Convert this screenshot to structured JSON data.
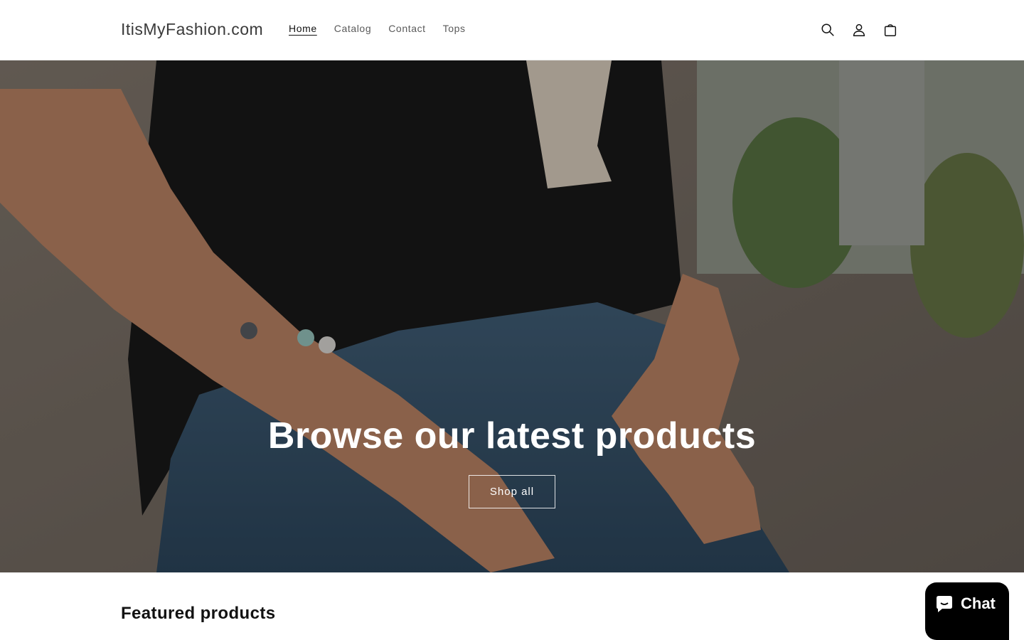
{
  "header": {
    "logo": "ItisMyFashion.com",
    "nav": [
      {
        "label": "Home",
        "active": true
      },
      {
        "label": "Catalog",
        "active": false
      },
      {
        "label": "Contact",
        "active": false
      },
      {
        "label": "Tops",
        "active": false
      }
    ],
    "icons": [
      "search-icon",
      "account-icon",
      "cart-icon"
    ]
  },
  "hero": {
    "title": "Browse our latest products",
    "button_label": "Shop all"
  },
  "featured": {
    "heading": "Featured products"
  },
  "chat": {
    "label": "Chat",
    "icon": "chat-bubble-icon"
  },
  "colors": {
    "text": "#121212",
    "background": "#ffffff",
    "chat_bg": "#000000"
  }
}
